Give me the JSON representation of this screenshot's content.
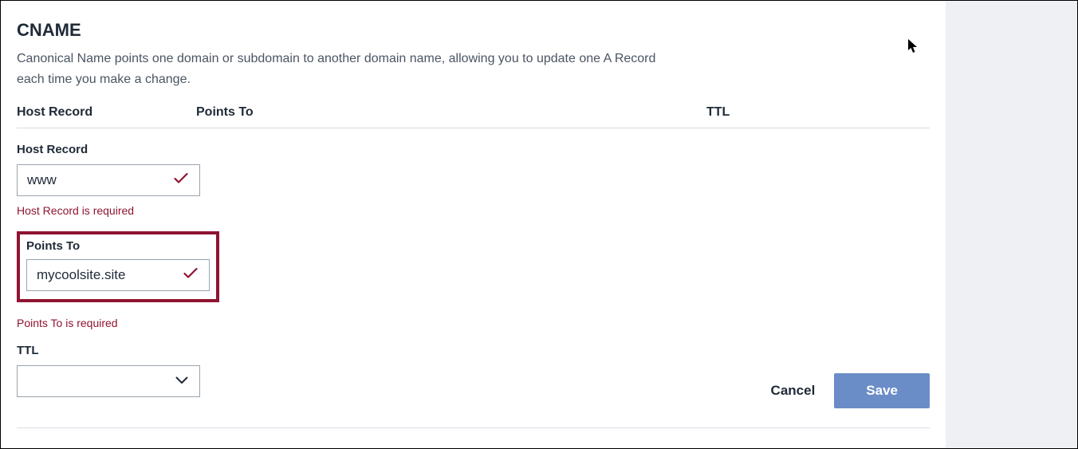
{
  "title": "CNAME",
  "description": "Canonical Name points one domain or subdomain to another domain name, allowing you to update one A Record each time you make a change.",
  "columns": {
    "host": "Host Record",
    "points": "Points To",
    "ttl": "TTL"
  },
  "fields": {
    "hostRecord": {
      "label": "Host Record",
      "value": "www",
      "error": "Host Record is required"
    },
    "pointsTo": {
      "label": "Points To",
      "value": "mycoolsite.site",
      "error": "Points To is required"
    },
    "ttl": {
      "label": "TTL",
      "value": ""
    }
  },
  "actions": {
    "cancel": "Cancel",
    "save": "Save"
  }
}
